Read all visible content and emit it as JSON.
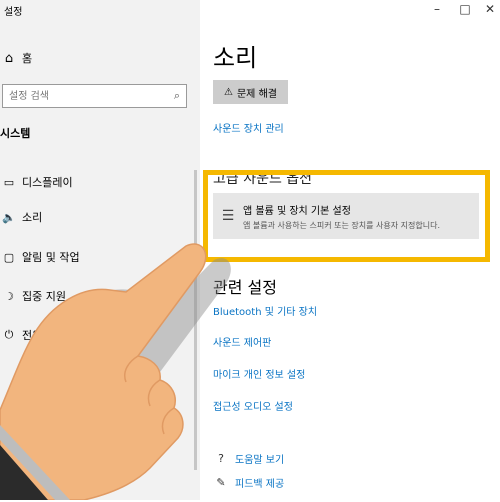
{
  "window": {
    "title": "설정",
    "minimize_icon": "minimize-icon",
    "maximize_icon": "maximize-icon",
    "close_icon": "close-icon",
    "minimize_glyph": "–",
    "maximize_glyph": "□",
    "close_glyph": "✕"
  },
  "sidebar": {
    "home": {
      "label": "홈",
      "icon": "home-icon",
      "glyph": "⌂"
    },
    "search": {
      "placeholder": "설정 검색",
      "icon": "search-icon",
      "glyph": "⌕"
    },
    "section_header": "시스템",
    "items": [
      {
        "label": "디스플레이",
        "icon": "monitor-icon",
        "glyph": "▭"
      },
      {
        "label": "소리",
        "icon": "speaker-icon",
        "glyph": "🔈"
      },
      {
        "label": "알림 및 작업",
        "icon": "notification-icon",
        "glyph": "▢"
      },
      {
        "label": "집중 지원",
        "icon": "moon-icon",
        "glyph": "☽"
      },
      {
        "label": "전원",
        "icon": "power-icon",
        "glyph": "⏻"
      }
    ],
    "partial_items": [
      {
        "label": "시"
      }
    ]
  },
  "main": {
    "title": "소리",
    "troubleshoot": {
      "label": "문제 해결",
      "icon": "warning-icon",
      "glyph": "⚠"
    },
    "device_link": "사운드 장치 관리",
    "advanced_heading": "고급 사운드 옵션",
    "app_volume": {
      "title": "앱 볼륨 및 장치 기본 설정",
      "description": "앱 볼륨과 사용하는 스피커 또는 장치를 사용자 지정합니다.",
      "icon": "sliders-icon",
      "glyph": "☰"
    },
    "related_heading": "관련 설정",
    "related_links": [
      "Bluetooth 및 기타 장치",
      "사운드 제어판",
      "마이크 개인 정보 설정",
      "접근성 오디오 설정"
    ],
    "help_links": [
      {
        "label": "도움말 보기",
        "icon": "help-icon",
        "glyph": "?"
      },
      {
        "label": "피드백 제공",
        "icon": "feedback-icon",
        "glyph": "✎"
      }
    ]
  },
  "colors": {
    "accent_link": "#0a74c4",
    "highlight_border": "#f5b800",
    "hand_skin": "#f2b57e"
  }
}
